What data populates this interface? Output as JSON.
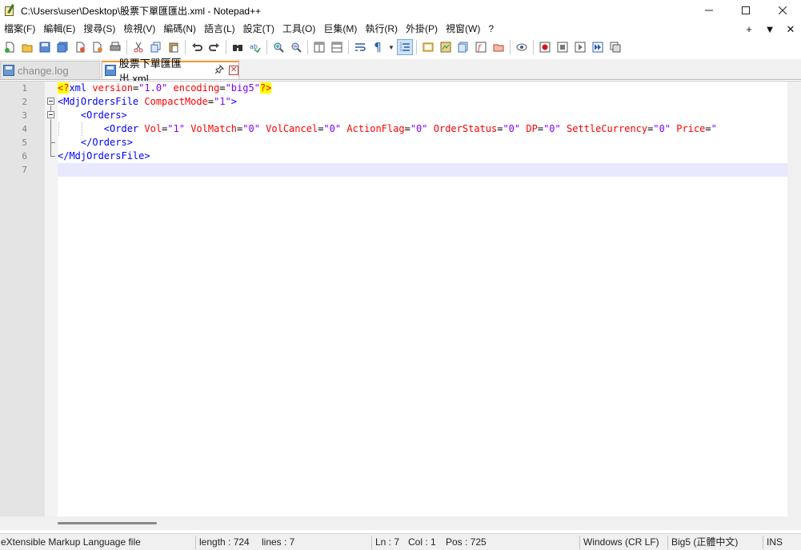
{
  "window": {
    "title": "C:\\Users\\user\\Desktop\\股票下單匯匯出.xml - Notepad++",
    "controls": {
      "minimize": "—",
      "maximize": "☐",
      "close": "✕"
    }
  },
  "menu": {
    "items": [
      "檔案(F)",
      "編輯(E)",
      "搜尋(S)",
      "檢視(V)",
      "編碼(N)",
      "語言(L)",
      "設定(T)",
      "工具(O)",
      "巨集(M)",
      "執行(R)",
      "外掛(P)",
      "視窗(W)",
      "?"
    ],
    "right": [
      "+",
      "▼",
      "✕"
    ]
  },
  "toolbar": {
    "icons": [
      "new-file-icon",
      "open-file-icon",
      "save-icon",
      "save-all-icon",
      "close-icon",
      "close-all-icon",
      "print-icon",
      "cut-icon",
      "copy-icon",
      "paste-icon",
      "undo-icon",
      "redo-icon",
      "find-icon",
      "replace-icon",
      "zoom-in-icon",
      "zoom-out-icon",
      "sync-vertical-icon",
      "sync-horizontal-icon",
      "word-wrap-icon",
      "show-all-chars-icon",
      "indent-guide-icon",
      "udl-icon",
      "doc-map-icon",
      "doc-list-icon",
      "function-list-icon",
      "folder-workspace-icon",
      "monitor-icon",
      "record-macro-icon",
      "stop-record-icon",
      "play-macro-icon",
      "run-macro-multiple-icon",
      "save-macro-icon"
    ]
  },
  "tabs": [
    {
      "label": "change.log",
      "active": false
    },
    {
      "label": "股票下單匯匯出.xml",
      "active": true,
      "pin": "📌",
      "close": "✕"
    }
  ],
  "editor": {
    "line_numbers": [
      "1",
      "2",
      "3",
      "4",
      "5",
      "6",
      "7"
    ],
    "current_line": 7,
    "lines": [
      [
        {
          "t": "<?",
          "c": "pi"
        },
        {
          "t": "xml",
          "c": "tag"
        },
        {
          "t": " version",
          "c": "attr"
        },
        {
          "t": "=",
          "c": "eq"
        },
        {
          "t": "\"1.0\"",
          "c": "val"
        },
        {
          "t": " encoding",
          "c": "attr"
        },
        {
          "t": "=",
          "c": "eq"
        },
        {
          "t": "\"big5\"",
          "c": "val"
        },
        {
          "t": "?>",
          "c": "pi"
        }
      ],
      [
        {
          "t": "<MdjOrdersFile",
          "c": "tag"
        },
        {
          "t": " CompactMode",
          "c": "attr"
        },
        {
          "t": "=",
          "c": "eq"
        },
        {
          "t": "\"1\"",
          "c": "val"
        },
        {
          "t": ">",
          "c": "tag"
        }
      ],
      [
        {
          "t": "    ",
          "c": "eq"
        },
        {
          "t": "<Orders>",
          "c": "tag"
        }
      ],
      [
        {
          "t": "        ",
          "c": "eq"
        },
        {
          "t": "<Order",
          "c": "tag"
        },
        {
          "t": " Vol",
          "c": "attr"
        },
        {
          "t": "=",
          "c": "eq"
        },
        {
          "t": "\"1\"",
          "c": "val"
        },
        {
          "t": " VolMatch",
          "c": "attr"
        },
        {
          "t": "=",
          "c": "eq"
        },
        {
          "t": "\"0\"",
          "c": "val"
        },
        {
          "t": " VolCancel",
          "c": "attr"
        },
        {
          "t": "=",
          "c": "eq"
        },
        {
          "t": "\"0\"",
          "c": "val"
        },
        {
          "t": " ActionFlag",
          "c": "attr"
        },
        {
          "t": "=",
          "c": "eq"
        },
        {
          "t": "\"0\"",
          "c": "val"
        },
        {
          "t": " OrderStatus",
          "c": "attr"
        },
        {
          "t": "=",
          "c": "eq"
        },
        {
          "t": "\"0\"",
          "c": "val"
        },
        {
          "t": " DP",
          "c": "attr"
        },
        {
          "t": "=",
          "c": "eq"
        },
        {
          "t": "\"0\"",
          "c": "val"
        },
        {
          "t": " SettleCurrency",
          "c": "attr"
        },
        {
          "t": "=",
          "c": "eq"
        },
        {
          "t": "\"0\"",
          "c": "val"
        },
        {
          "t": " Price",
          "c": "attr"
        },
        {
          "t": "=",
          "c": "eq"
        },
        {
          "t": "\"",
          "c": "val"
        }
      ],
      [
        {
          "t": "    ",
          "c": "eq"
        },
        {
          "t": "</Orders>",
          "c": "tag"
        }
      ],
      [
        {
          "t": "</MdjOrdersFile>",
          "c": "tag"
        }
      ],
      []
    ]
  },
  "status": {
    "file_type": "eXtensible Markup Language file",
    "length": "length : 724",
    "lines": "lines : 7",
    "ln": "Ln : 7",
    "col": "Col : 1",
    "pos": "Pos : 725",
    "eol": "Windows (CR LF)",
    "encoding": "Big5 (正體中文)",
    "mode": "INS"
  },
  "colors": {
    "pi_bg": "#ffff00",
    "tag": "#0000ff",
    "attr": "#ff0000",
    "value": "#8000ff",
    "current_line": "#e8e8ff",
    "tab_accent": "#f29b38"
  }
}
